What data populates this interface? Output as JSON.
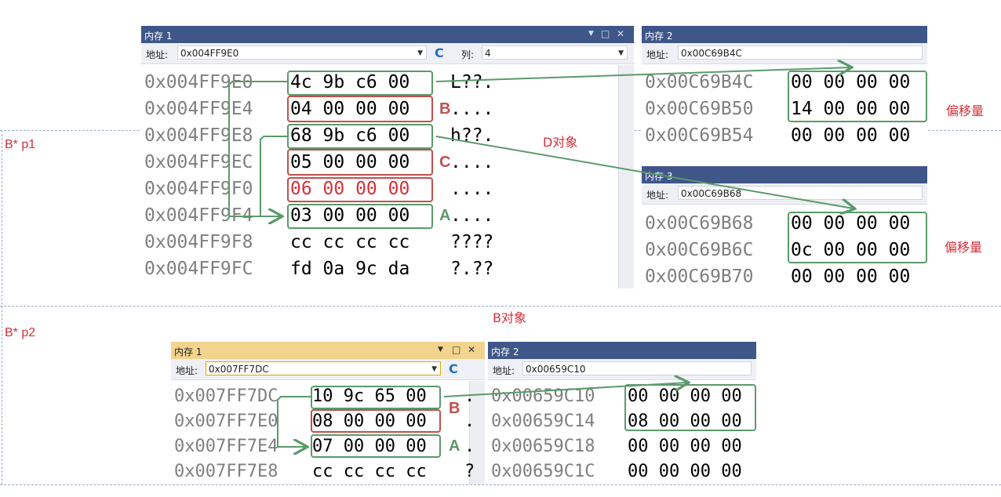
{
  "side_labels": {
    "p1": "B* p1",
    "p2": "B* p2"
  },
  "notes": {
    "d_object": "D对象",
    "b_object": "B对象",
    "offset_1": "偏移量",
    "offset_2": "偏移量"
  },
  "window_controls": {
    "menu": "▼",
    "restore": "□",
    "close": "✕",
    "dropdown": "▼",
    "refresh": "C"
  },
  "top_mem1": {
    "title": "内存 1",
    "addr_label": "地址:",
    "address": "0x004FF9E0",
    "col_label": "列:",
    "col_value": "4",
    "rows": [
      {
        "addr": "0x004FF9E0",
        "bytes": "4c 9b c6 00",
        "chars": "L??."
      },
      {
        "addr": "0x004FF9E4",
        "bytes": "04 00 00 00",
        "chars": "...."
      },
      {
        "addr": "0x004FF9E8",
        "bytes": "68 9b c6 00",
        "chars": "h??."
      },
      {
        "addr": "0x004FF9EC",
        "bytes": "05 00 00 00",
        "chars": "...."
      },
      {
        "addr": "0x004FF9F0",
        "bytes": "06 00 00 00",
        "chars": "...."
      },
      {
        "addr": "0x004FF9F4",
        "bytes": "03 00 00 00",
        "chars": "...."
      },
      {
        "addr": "0x004FF9F8",
        "bytes": "cc cc cc cc",
        "chars": "????"
      },
      {
        "addr": "0x004FF9FC",
        "bytes": "fd 0a 9c da",
        "chars": "?.??"
      }
    ],
    "markers": {
      "b": "B",
      "c": "C",
      "a": "A"
    }
  },
  "top_mem2": {
    "title": "内存 2",
    "addr_label": "地址:",
    "address": "0x00C69B4C",
    "rows": [
      {
        "addr": "0x00C69B4C",
        "bytes": "00 00 00 00"
      },
      {
        "addr": "0x00C69B50",
        "bytes": "14 00 00 00"
      },
      {
        "addr": "0x00C69B54",
        "bytes": "00 00 00 00"
      }
    ]
  },
  "top_mem3": {
    "title": "内存 3",
    "addr_label": "地址:",
    "address": "0x00C69B68",
    "rows": [
      {
        "addr": "0x00C69B68",
        "bytes": "00 00 00 00"
      },
      {
        "addr": "0x00C69B6C",
        "bytes": "0c 00 00 00"
      },
      {
        "addr": "0x00C69B70",
        "bytes": "00 00 00 00"
      }
    ]
  },
  "bot_mem1": {
    "title": "内存 1",
    "addr_label": "地址:",
    "address": "0x007FF7DC",
    "rows": [
      {
        "addr": "0x007FF7DC",
        "bytes": "10 9c 65 00",
        "chars": "."
      },
      {
        "addr": "0x007FF7E0",
        "bytes": "08 00 00 00",
        "chars": "."
      },
      {
        "addr": "0x007FF7E4",
        "bytes": "07 00 00 00",
        "chars": "."
      },
      {
        "addr": "0x007FF7E8",
        "bytes": "cc cc cc cc",
        "chars": "?"
      }
    ],
    "markers": {
      "b": "B",
      "a": "A"
    }
  },
  "bot_mem2": {
    "title": "内存 2",
    "addr_label": "地址:",
    "address": "0x00659C10",
    "rows": [
      {
        "addr": "0x00659C10",
        "bytes": "00 00 00 00"
      },
      {
        "addr": "0x00659C14",
        "bytes": "08 00 00 00"
      },
      {
        "addr": "0x00659C18",
        "bytes": "00 00 00 00"
      },
      {
        "addr": "0x00659C1C",
        "bytes": "00 00 00 00"
      }
    ]
  },
  "colors": {
    "title_blue": "#3f5688",
    "title_gold": "#f3d48e",
    "annot_red": "#d6303a",
    "box_green": "#5a9a6a",
    "box_red": "#c0504d"
  }
}
